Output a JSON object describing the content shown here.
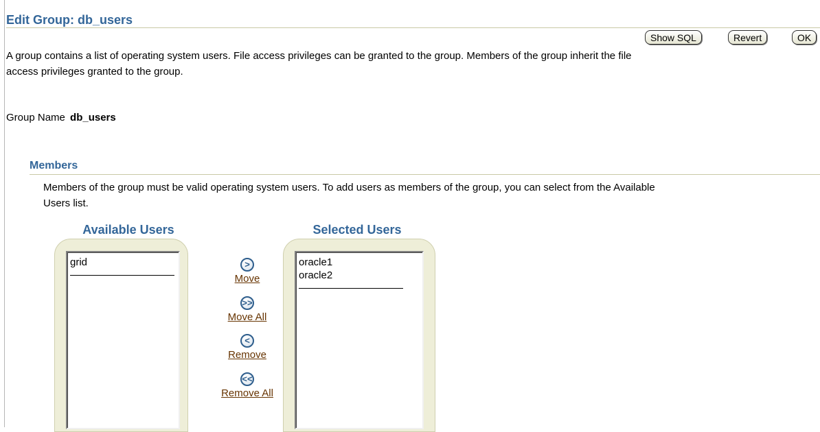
{
  "page": {
    "title": "Edit Group: db_users",
    "description_line1": "A group contains a list of operating system users. File access privileges can be granted to the group. Members of the group inherit the file",
    "description_line2": "access privileges granted to the group."
  },
  "toolbar": {
    "show_sql_label": "Show SQL",
    "revert_label": "Revert",
    "ok_label": "OK"
  },
  "group": {
    "name_label": "Group Name",
    "name_value": "db_users"
  },
  "members": {
    "section_title": "Members",
    "description_line1": "Members of the group must be valid operating system users. To add users as members of the group, you can select from the Available",
    "description_line2": "Users list."
  },
  "shuttle": {
    "available_header": "Available Users",
    "selected_header": "Selected Users",
    "available_items": [
      "grid"
    ],
    "selected_items": [
      "oracle1",
      "oracle2"
    ],
    "actions": {
      "move": "Move",
      "move_all": "Move All",
      "remove": "Remove",
      "remove_all": "Remove All"
    },
    "icons": {
      "move": "move-right-icon",
      "move_all": "move-all-right-icon",
      "remove": "remove-left-icon",
      "remove_all": "remove-all-left-icon"
    }
  },
  "colors": {
    "header_blue": "#336699",
    "link_brown": "#663300",
    "panel_beige": "#eeeed8"
  }
}
